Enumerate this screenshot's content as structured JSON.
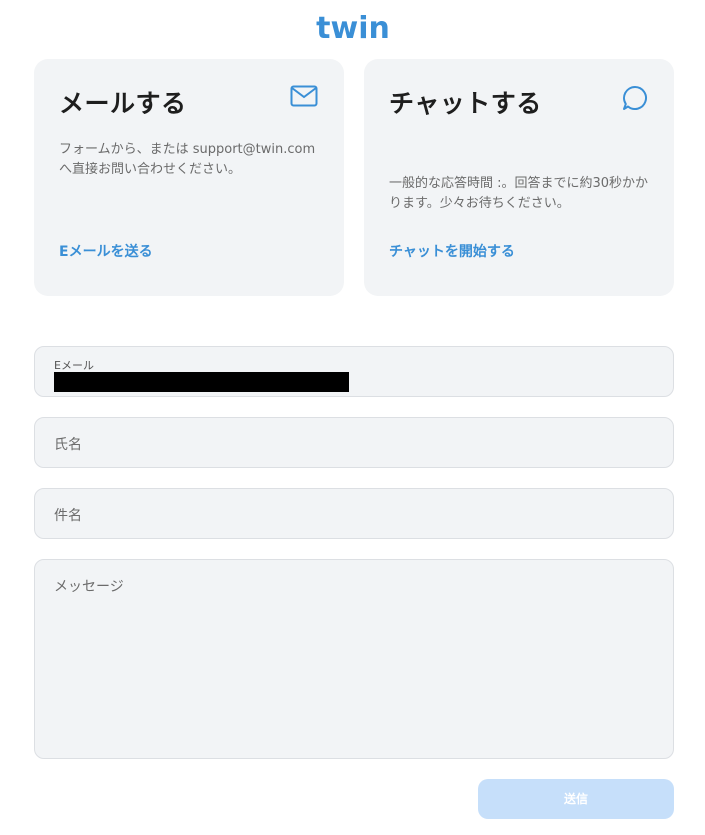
{
  "brand": {
    "logo_text": "twin",
    "color": "#3a8fd6"
  },
  "email_card": {
    "title": "メールする",
    "description": "フォームから、または support@twin.comへ直接お問い合わせください。",
    "link": "Eメールを送る",
    "icon": "mail-icon"
  },
  "chat_card": {
    "title": "チャットする",
    "description": "一般的な応答時間 :。回答までに約30秒かかります。少々お待ちください。",
    "link": "チャットを開始する",
    "icon": "chat-bubble-icon"
  },
  "form": {
    "email_label": "Eメール",
    "email_value_redacted": true,
    "name_placeholder": "氏名",
    "subject_placeholder": "件名",
    "message_placeholder": "メッセージ",
    "submit_label": "送信"
  },
  "colors": {
    "card_bg": "#f2f4f6",
    "link": "#3a8fd6",
    "submit_disabled": "#c6dffa"
  }
}
